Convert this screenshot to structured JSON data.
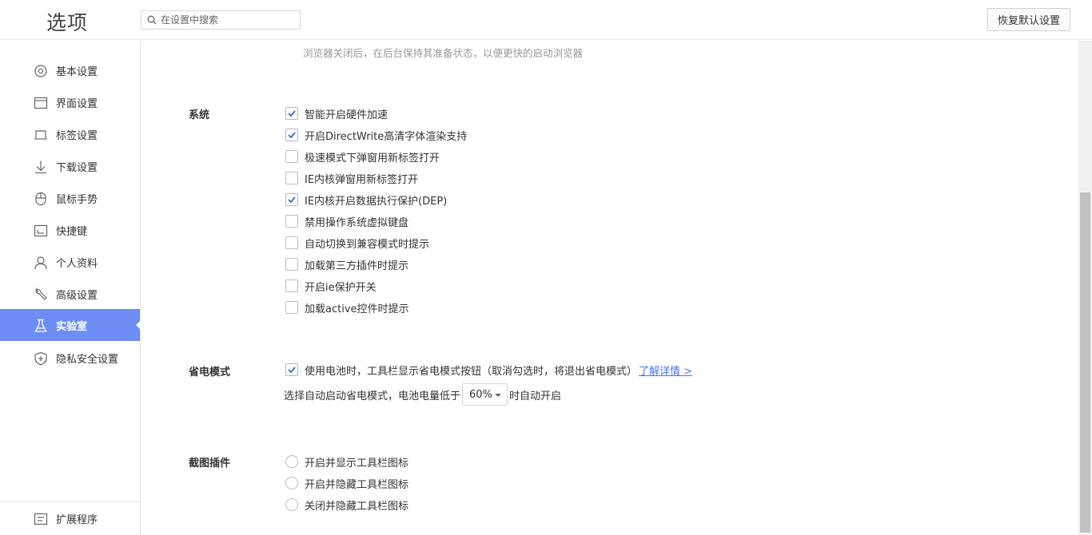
{
  "header": {
    "title": "选项",
    "search_placeholder": "在设置中搜索",
    "restore_label": "恢复默认设置"
  },
  "sidebar": {
    "items": [
      {
        "label": "基本设置",
        "icon": "settings-icon"
      },
      {
        "label": "界面设置",
        "icon": "window-icon"
      },
      {
        "label": "标签设置",
        "icon": "tab-icon"
      },
      {
        "label": "下载设置",
        "icon": "download-icon"
      },
      {
        "label": "鼠标手势",
        "icon": "mouse-icon"
      },
      {
        "label": "快捷键",
        "icon": "keyboard-icon"
      },
      {
        "label": "个人资料",
        "icon": "user-icon"
      },
      {
        "label": "高级设置",
        "icon": "wrench-icon"
      },
      {
        "label": "实验室",
        "icon": "flask-icon",
        "active": true
      },
      {
        "label": "隐私安全设置",
        "icon": "shield-icon"
      }
    ],
    "extensions_label": "扩展程序",
    "active_color": "#6d8df5"
  },
  "main": {
    "hint": "浏览器关闭后，在后台保持其准备状态，以便更快的启动浏览器",
    "system": {
      "title": "系统",
      "options": [
        {
          "label": "智能开启硬件加速",
          "checked": true
        },
        {
          "label": "开启DirectWrite高清字体渲染支持",
          "checked": true
        },
        {
          "label": "极速模式下弹窗用新标签打开",
          "checked": false
        },
        {
          "label": "IE内核弹窗用新标签打开",
          "checked": false
        },
        {
          "label": "IE内核开启数据执行保护(DEP)",
          "checked": true
        },
        {
          "label": "禁用操作系统虚拟键盘",
          "checked": false
        },
        {
          "label": "自动切换到兼容模式时提示",
          "checked": false
        },
        {
          "label": "加载第三方插件时提示",
          "checked": false
        },
        {
          "label": "开启ie保护开关",
          "checked": false
        },
        {
          "label": "加载active控件时提示",
          "checked": false
        }
      ]
    },
    "power": {
      "title": "省电模式",
      "option_label": "使用电池时，工具栏显示省电模式按钮（取消勾选时，将退出省电模式）",
      "option_checked": true,
      "learn_more": "了解详情 >",
      "battery_prefix": "选择自动启动省电模式，电池电量低于",
      "battery_value": "60%",
      "battery_suffix": "时自动开启"
    },
    "screenshot": {
      "title": "截图插件",
      "options": [
        {
          "label": "开启并显示工具栏图标"
        },
        {
          "label": "开启并隐藏工具栏图标"
        },
        {
          "label": "关闭并隐藏工具栏图标"
        }
      ]
    }
  }
}
